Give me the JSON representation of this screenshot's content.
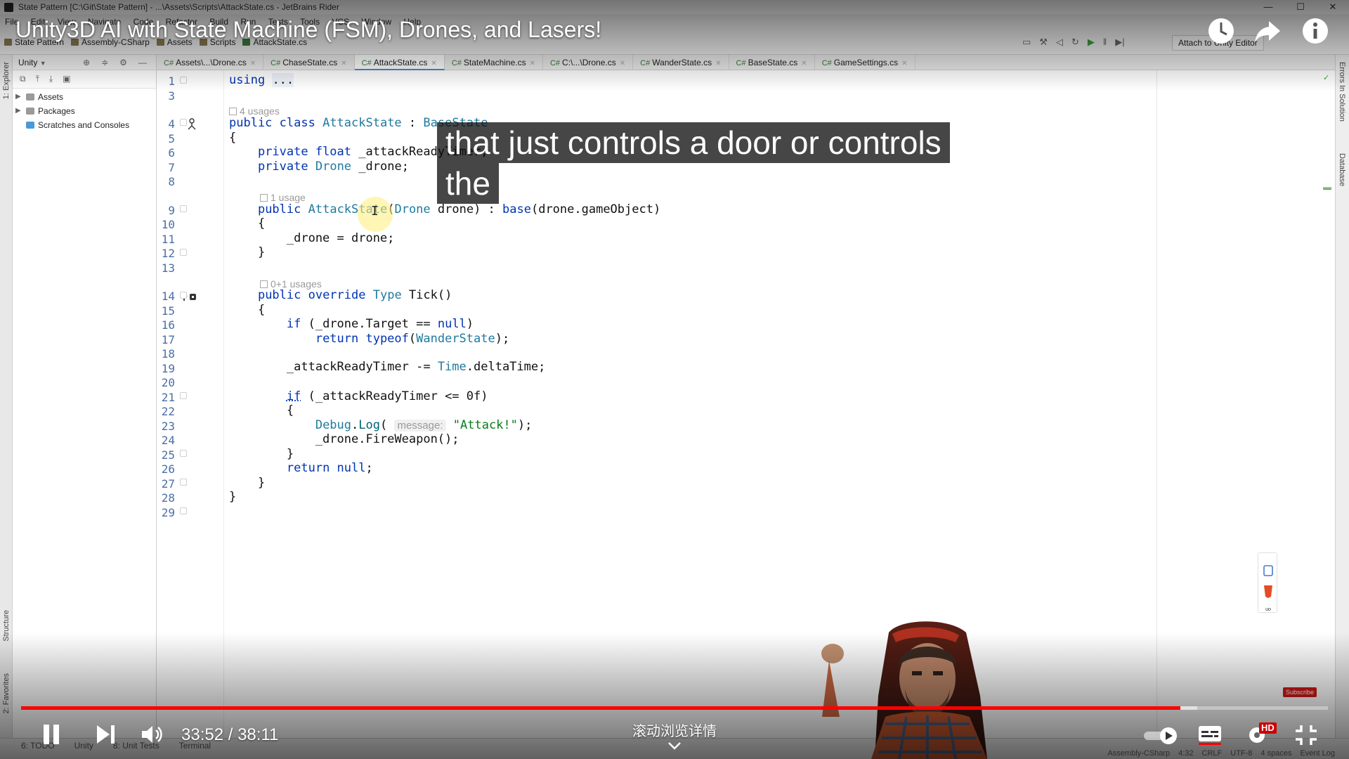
{
  "window": {
    "title": "State Pattern [C:\\Git\\State Pattern] - ...\\Assets\\Scripts\\AttackState.cs - JetBrains Rider",
    "minimize": "—",
    "maximize": "☐",
    "close": "✕"
  },
  "menu": [
    "File",
    "Edit",
    "View",
    "Navigate",
    "Code",
    "Refactor",
    "Build",
    "Run",
    "Tests",
    "Tools",
    "VCS",
    "Window",
    "Help"
  ],
  "breadcrumbs": [
    "State Pattern",
    "Assembly-CSharp",
    "Assets",
    "Scripts",
    "AttackState.cs"
  ],
  "toolbar": {
    "attach_label": "Attach to Unity Editor"
  },
  "project_panel": {
    "title": "Unity",
    "tree": [
      {
        "label": "Assets",
        "expandable": true
      },
      {
        "label": "Packages",
        "expandable": true
      },
      {
        "label": "Scratches and Consoles",
        "expandable": false
      }
    ]
  },
  "tool_windows": {
    "left": [
      "1: Explorer",
      "Structure",
      "2: Favorites"
    ],
    "right": [
      "Errors In Solution",
      "Database"
    ]
  },
  "tabs": [
    {
      "label": "Assets\\...\\Drone.cs",
      "active": false
    },
    {
      "label": "ChaseState.cs",
      "active": false
    },
    {
      "label": "AttackState.cs",
      "active": true
    },
    {
      "label": "StateMachine.cs",
      "active": false
    },
    {
      "label": "C:\\...\\Drone.cs",
      "active": false
    },
    {
      "label": "WanderState.cs",
      "active": false
    },
    {
      "label": "BaseState.cs",
      "active": false
    },
    {
      "label": "GameSettings.cs",
      "active": false
    }
  ],
  "code": {
    "line_numbers": [
      "1",
      "3",
      "4",
      "5",
      "6",
      "7",
      "8",
      "9",
      "10",
      "11",
      "12",
      "13",
      "14",
      "15",
      "16",
      "17",
      "18",
      "19",
      "20",
      "21",
      "22",
      "23",
      "24",
      "25",
      "26",
      "27",
      "28",
      "29"
    ],
    "usages": [
      "4 usages",
      "1 usage",
      "0+1 usages"
    ],
    "param_hint": "message:"
  },
  "status_bar": {
    "tool_windows": [
      "6: TODO",
      "Unity",
      "8: Unit Tests",
      "Terminal"
    ],
    "context": "Assembly-CSharp",
    "caret": "4:32",
    "line_sep": "CRLF",
    "encoding": "UTF-8",
    "indent": "4 spaces",
    "event_log": "Event Log"
  },
  "video": {
    "title": "Unity3D AI with State Machine (FSM), Drones, and Lasers!",
    "caption_line1": "that just controls a door or controls",
    "caption_line2": "the",
    "current_time": "33:52",
    "duration": "38:11",
    "time_display": "33:52 / 38:11",
    "progress_fraction": 0.8869,
    "buffered_fraction": 0.9,
    "scroll_hint": "滚动浏览详情",
    "quality_badge": "HD",
    "subscribe_label": "Subscribe"
  },
  "colors": {
    "keyword": "#0033b3",
    "type": "#1f7a9e",
    "string": "#067d17",
    "progress": "#ff0000"
  }
}
